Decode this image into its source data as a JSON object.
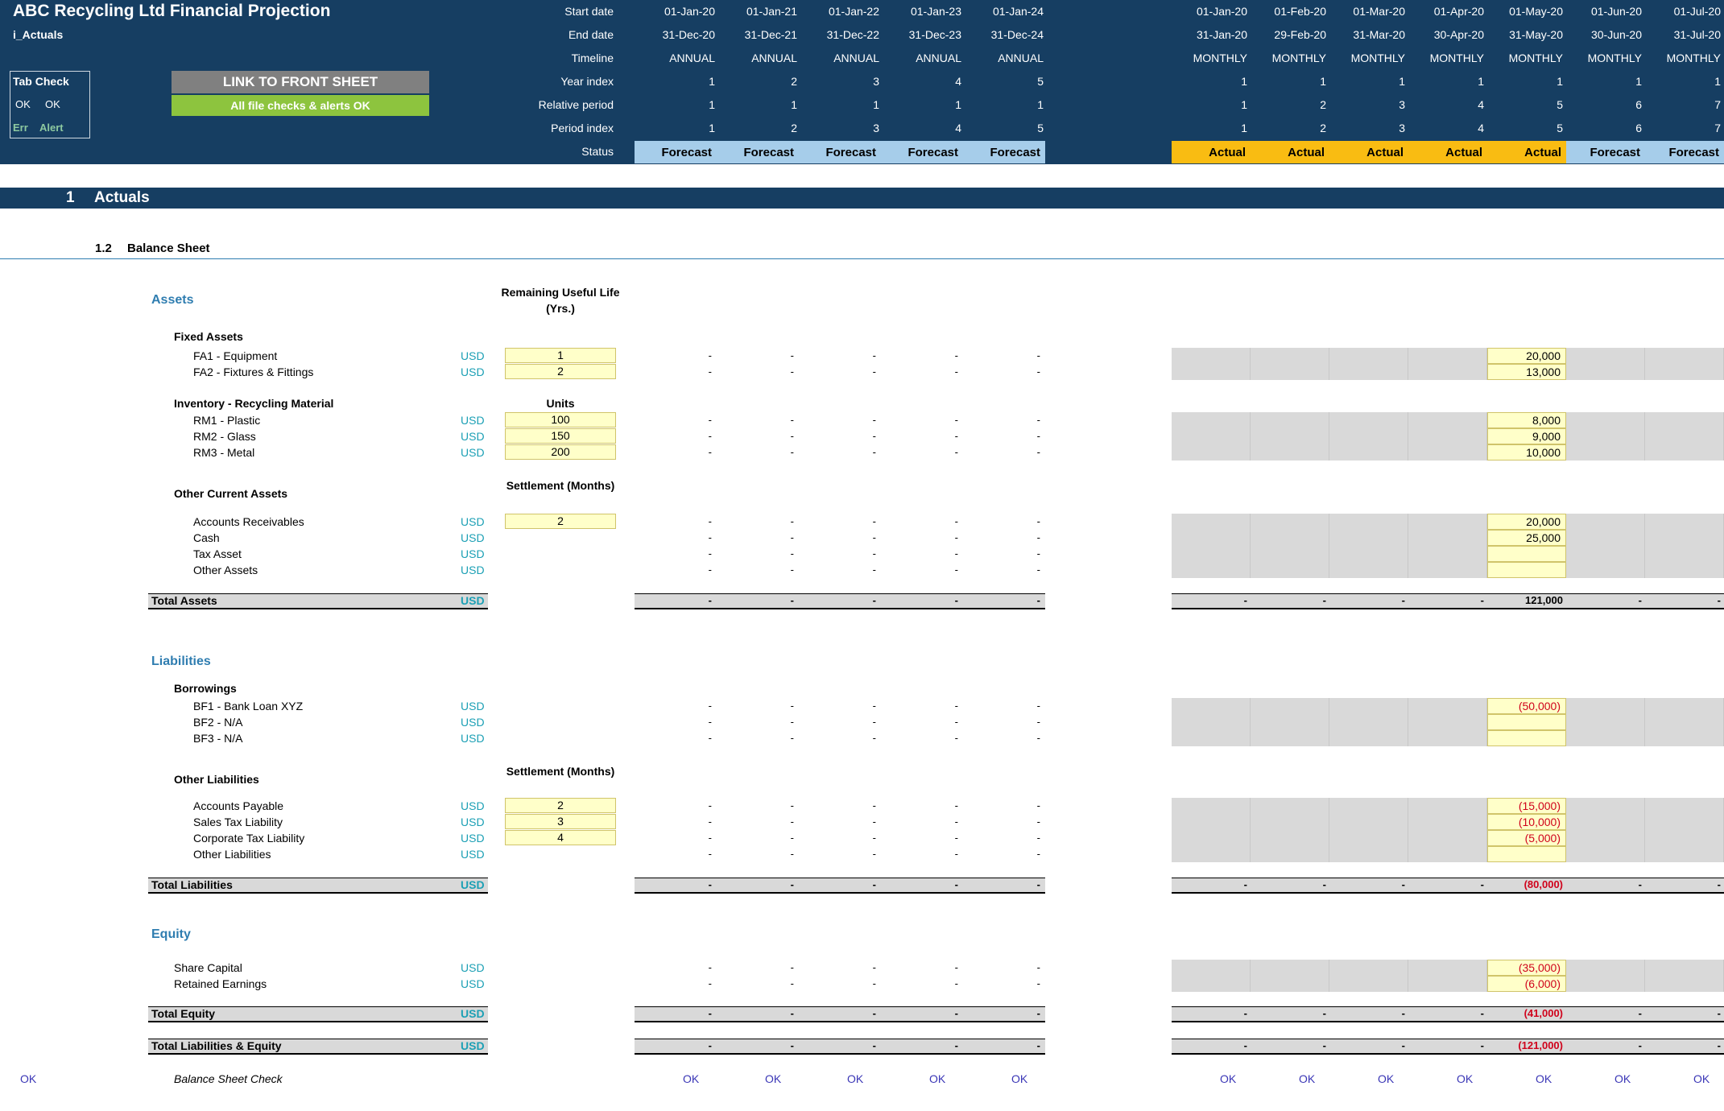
{
  "header": {
    "title": "ABC Recycling Ltd Financial Projection",
    "sheet": "i_Actuals",
    "tab_check": {
      "label": "Tab Check",
      "ok1": "OK",
      "ok2": "OK",
      "err": "Err",
      "alert": "Alert"
    },
    "link_button": "LINK TO FRONT SHEET",
    "checks_status": "All file checks & alerts OK",
    "row_labels": [
      "Start date",
      "End date",
      "Timeline",
      "Year index",
      "Relative period",
      "Period index",
      "Status"
    ],
    "annual": [
      {
        "start": "01-Jan-20",
        "end": "31-Dec-20",
        "timeline": "ANNUAL",
        "year": "1",
        "rel": "1",
        "period": "1",
        "status": "Forecast"
      },
      {
        "start": "01-Jan-21",
        "end": "31-Dec-21",
        "timeline": "ANNUAL",
        "year": "2",
        "rel": "1",
        "period": "2",
        "status": "Forecast"
      },
      {
        "start": "01-Jan-22",
        "end": "31-Dec-22",
        "timeline": "ANNUAL",
        "year": "3",
        "rel": "1",
        "period": "3",
        "status": "Forecast"
      },
      {
        "start": "01-Jan-23",
        "end": "31-Dec-23",
        "timeline": "ANNUAL",
        "year": "4",
        "rel": "1",
        "period": "4",
        "status": "Forecast"
      },
      {
        "start": "01-Jan-24",
        "end": "31-Dec-24",
        "timeline": "ANNUAL",
        "year": "5",
        "rel": "1",
        "period": "5",
        "status": "Forecast"
      }
    ],
    "monthly": [
      {
        "start": "01-Jan-20",
        "end": "31-Jan-20",
        "timeline": "MONTHLY",
        "year": "1",
        "rel": "1",
        "period": "1",
        "status": "Actual"
      },
      {
        "start": "01-Feb-20",
        "end": "29-Feb-20",
        "timeline": "MONTHLY",
        "year": "1",
        "rel": "2",
        "period": "2",
        "status": "Actual"
      },
      {
        "start": "01-Mar-20",
        "end": "31-Mar-20",
        "timeline": "MONTHLY",
        "year": "1",
        "rel": "3",
        "period": "3",
        "status": "Actual"
      },
      {
        "start": "01-Apr-20",
        "end": "30-Apr-20",
        "timeline": "MONTHLY",
        "year": "1",
        "rel": "4",
        "period": "4",
        "status": "Actual"
      },
      {
        "start": "01-May-20",
        "end": "31-May-20",
        "timeline": "MONTHLY",
        "year": "1",
        "rel": "5",
        "period": "5",
        "status": "Actual"
      },
      {
        "start": "01-Jun-20",
        "end": "30-Jun-20",
        "timeline": "MONTHLY",
        "year": "1",
        "rel": "6",
        "period": "6",
        "status": "Forecast"
      },
      {
        "start": "01-Jul-20",
        "end": "31-Jul-20",
        "timeline": "MONTHLY",
        "year": "1",
        "rel": "7",
        "period": "7",
        "status": "Forecast"
      }
    ]
  },
  "section": {
    "number": "1",
    "title": "Actuals"
  },
  "subsection": {
    "number": "1.2",
    "title": "Balance Sheet"
  },
  "colheads": {
    "rul": "Remaining Useful Life (Yrs.)",
    "units": "Units",
    "settlement1": "Settlement (Months)",
    "settlement2": "Settlement (Months)"
  },
  "groups": {
    "assets": "Assets",
    "liabilities": "Liabilities",
    "equity": "Equity"
  },
  "subgroups": {
    "fixed": "Fixed Assets",
    "inventory": "Inventory - Recycling Material",
    "oca": "Other Current Assets",
    "borrowings": "Borrowings",
    "ol": "Other Liabilities"
  },
  "currency": "USD",
  "dash": "-",
  "rows": [
    {
      "label": "FA1 - Equipment",
      "input": "1",
      "may": "20,000",
      "neg": false
    },
    {
      "label": "FA2 - Fixtures & Fittings",
      "input": "2",
      "may": "13,000",
      "neg": false
    },
    {
      "label": "RM1 - Plastic",
      "input": "100",
      "may": "8,000",
      "neg": false
    },
    {
      "label": "RM2 - Glass",
      "input": "150",
      "may": "9,000",
      "neg": false
    },
    {
      "label": "RM3 - Metal",
      "input": "200",
      "may": "10,000",
      "neg": false
    },
    {
      "label": "Accounts Receivables",
      "input": "2",
      "may": "20,000",
      "neg": false
    },
    {
      "label": "Cash",
      "input": "",
      "may": "25,000",
      "neg": false
    },
    {
      "label": "Tax Asset",
      "input": "",
      "may": "",
      "neg": false
    },
    {
      "label": "Other Assets",
      "input": "",
      "may": "",
      "neg": false
    },
    {
      "label": "BF1 - Bank Loan XYZ",
      "input": "",
      "may": "(50,000)",
      "neg": true
    },
    {
      "label": "BF2 - N/A",
      "input": "",
      "may": "",
      "neg": false
    },
    {
      "label": "BF3 - N/A",
      "input": "",
      "may": "",
      "neg": false
    },
    {
      "label": "Accounts Payable",
      "input": "2",
      "may": "(15,000)",
      "neg": true
    },
    {
      "label": "Sales Tax Liability",
      "input": "3",
      "may": "(10,000)",
      "neg": true
    },
    {
      "label": "Corporate Tax Liability",
      "input": "4",
      "may": "(5,000)",
      "neg": true
    },
    {
      "label": "Other Liabilities",
      "input": "",
      "may": "",
      "neg": false
    },
    {
      "label": "Share Capital",
      "input": "",
      "may": "(35,000)",
      "neg": true
    },
    {
      "label": "Retained Earnings",
      "input": "",
      "may": "(6,000)",
      "neg": true
    }
  ],
  "totals": [
    {
      "label": "Total Assets",
      "may": "121,000",
      "neg": false
    },
    {
      "label": "Total Liabilities",
      "may": "(80,000)",
      "neg": true
    },
    {
      "label": "Total Equity",
      "may": "(41,000)",
      "neg": true
    },
    {
      "label": "Total Liabilities & Equity",
      "may": "(121,000)",
      "neg": true
    }
  ],
  "check": {
    "left_ok": "OK",
    "label": "Balance Sheet Check",
    "value": "OK"
  },
  "colors": {
    "header_bg": "#163e62",
    "forecast": "#a6cdea",
    "actual": "#f9bc12",
    "input": "#ffffc9",
    "ok_green": "#8dc43e",
    "negative": "#d0021b"
  }
}
